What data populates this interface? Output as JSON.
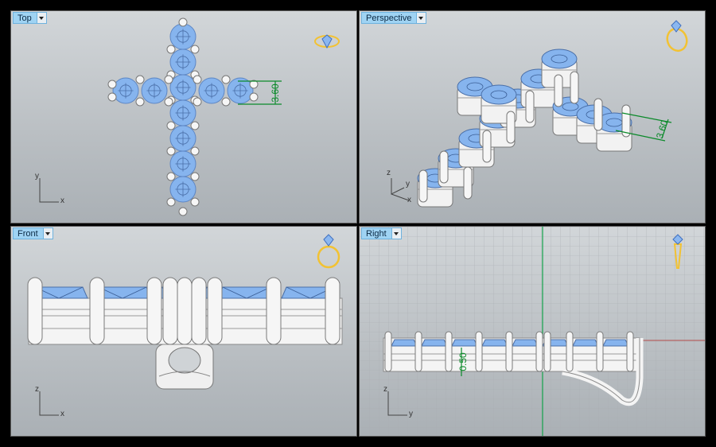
{
  "viewports": {
    "top": {
      "label": "Top",
      "dimension": "3.60",
      "axis_x": "x",
      "axis_y": "y"
    },
    "perspective": {
      "label": "Perspective",
      "dimension": "3.60",
      "axis_x": "x",
      "axis_y": "y",
      "axis_z": "z"
    },
    "front": {
      "label": "Front",
      "axis_x": "x",
      "axis_z": "z"
    },
    "right": {
      "label": "Right",
      "dimension": "0.50",
      "axis_y": "y",
      "axis_z": "z"
    }
  },
  "colors": {
    "stone": "#86b4ee",
    "metal": "#f2f2f2",
    "dimension": "#0b8a2a",
    "ring_icon": "#f2c233",
    "tab": "#9fd3f3"
  },
  "icons": [
    "ring-icon",
    "dropdown-arrow-icon"
  ]
}
